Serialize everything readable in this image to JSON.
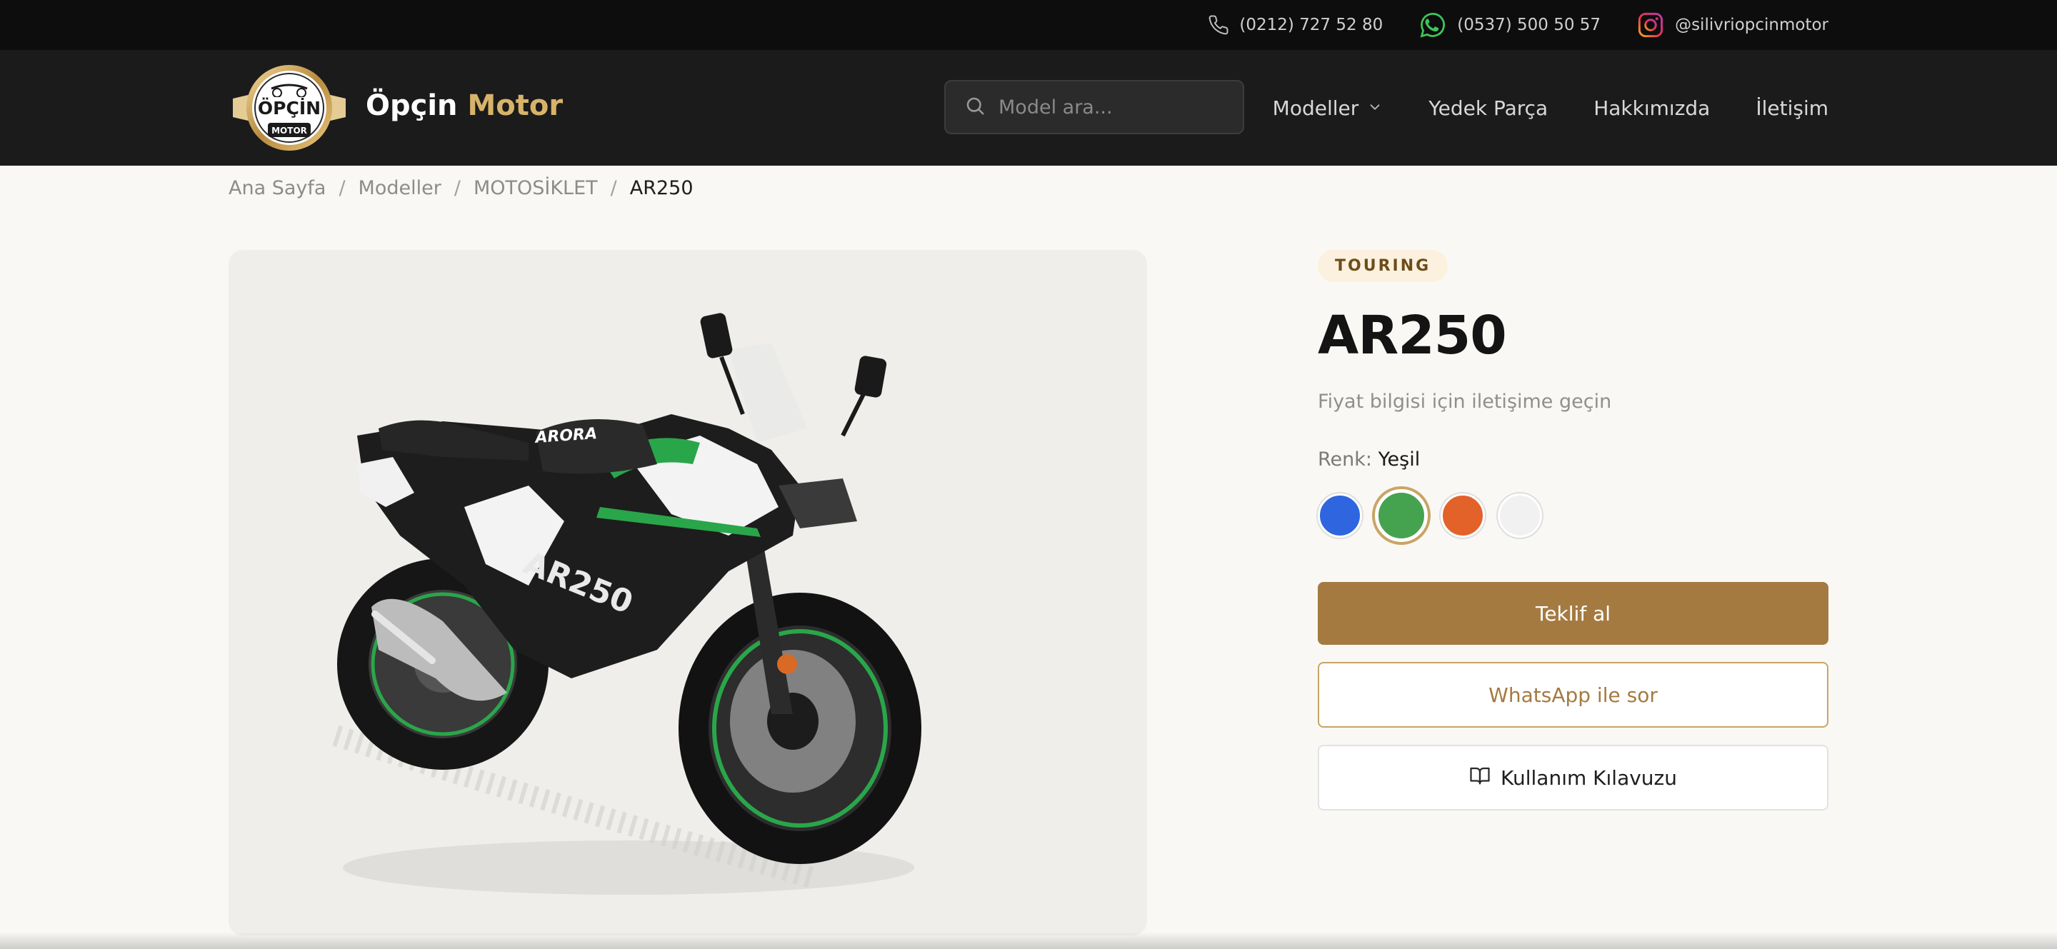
{
  "topbar": {
    "phone": "(0212) 727 52 80",
    "whatsapp": "(0537) 500 50 57",
    "instagram": "@silivriopcinmotor",
    "icons": [
      "phone-icon",
      "whatsapp-icon",
      "instagram-icon"
    ]
  },
  "header": {
    "logo_text_top": "ÖPÇİN",
    "logo_text_bottom": "MOTOR",
    "brand_white": "Öpçin",
    "brand_gold": "Motor",
    "search_placeholder": "Model ara...",
    "nav": {
      "models": "Modeller",
      "parts": "Yedek Parça",
      "about": "Hakkımızda",
      "contact": "İletişim"
    }
  },
  "breadcrumb": {
    "home": "Ana Sayfa",
    "models": "Modeller",
    "category": "MOTOSİKLET",
    "current": "AR250",
    "separator": "/"
  },
  "product": {
    "badge": "TOURING",
    "title": "AR250",
    "price_note": "Fiyat bilgisi için iletişime geçin",
    "color_label": "Renk:",
    "color_value": "Yeşil",
    "swatches": [
      "#2f66e0",
      "#45a350",
      "#e2622a",
      "#f1f1f1"
    ],
    "selected_swatch": 1,
    "image_text": {
      "brand": "ARORA",
      "model": "AR250"
    }
  },
  "actions": {
    "quote": "Teklif al",
    "whatsapp": "WhatsApp ile sor",
    "manual": "Kullanım Kılavuzu"
  },
  "colors": {
    "gold": "#a57a41",
    "gold_light": "#d7b36a",
    "header_bg": "#1b1b1b",
    "topbar_bg": "#0d0d0d"
  }
}
